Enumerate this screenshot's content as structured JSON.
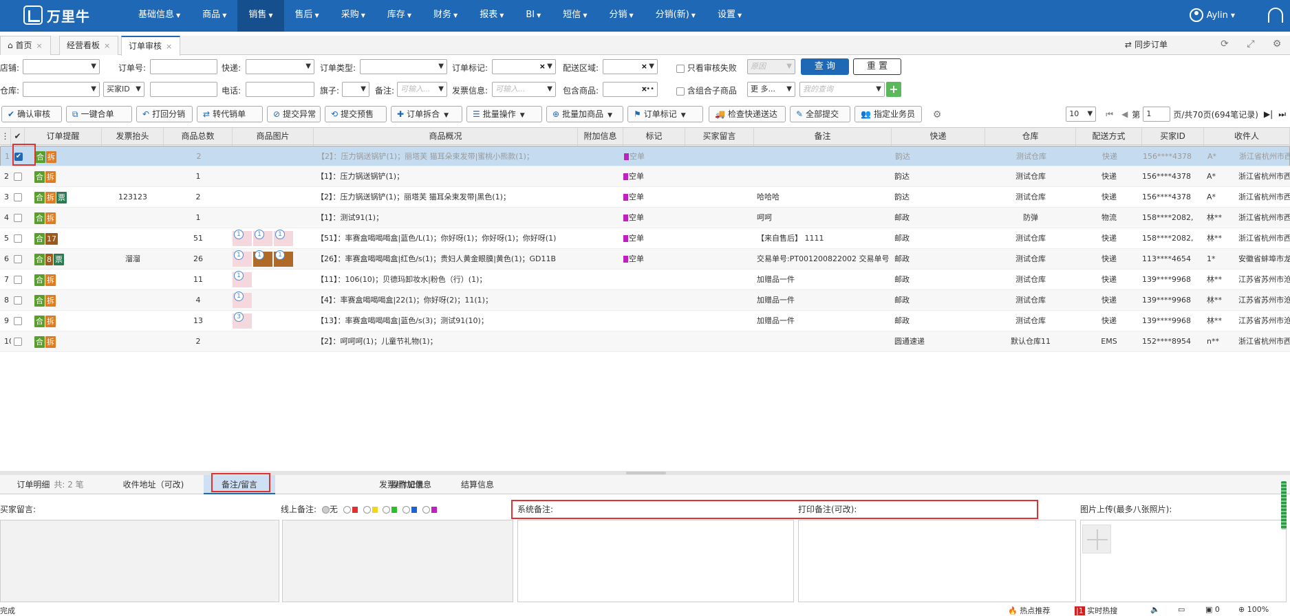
{
  "app": {
    "logo_text": "万里牛",
    "user": "Aylin"
  },
  "menu": [
    {
      "label": "基础信息"
    },
    {
      "label": "商品"
    },
    {
      "label": "销售",
      "active": true
    },
    {
      "label": "售后"
    },
    {
      "label": "采购"
    },
    {
      "label": "库存"
    },
    {
      "label": "财务"
    },
    {
      "label": "报表"
    },
    {
      "label": "BI"
    },
    {
      "label": "短信"
    },
    {
      "label": "分销"
    },
    {
      "label": "分销(新)"
    },
    {
      "label": "设置"
    }
  ],
  "tabs": [
    {
      "label": "首页"
    },
    {
      "label": "经营看板"
    },
    {
      "label": "订单审核",
      "active": true
    }
  ],
  "sync_label": "同步订单",
  "filters": {
    "row1": {
      "shop": "店铺:",
      "order_no": "订单号:",
      "express": "快递:",
      "order_type": "订单类型:",
      "order_mark": "订单标记:",
      "delivery_area": "配送区域:",
      "only_fail": "只看审核失败",
      "fail_select": "原因",
      "query": "查 询",
      "reset": "重 置"
    },
    "row2": {
      "warehouse": "仓库:",
      "buyer_id": "买家ID",
      "phone": "电话:",
      "flag": "旗子:",
      "remark": "备注:",
      "remark_ph": "可输入...",
      "invoice": "发票信息:",
      "invoice_ph": "可输入...",
      "contains": "包含商品:",
      "combo": "含组合子商品",
      "more": "更 多...",
      "my_query": "我的查询"
    }
  },
  "toolbar": [
    {
      "label": "确认审核",
      "icon": "check-icon"
    },
    {
      "label": "一键合单",
      "icon": "merge-icon"
    },
    {
      "label": "打回分销",
      "icon": "return-icon"
    },
    {
      "label": "转代销单",
      "icon": "transfer-icon"
    },
    {
      "label": "提交异常",
      "icon": "warning-icon"
    },
    {
      "label": "提交预售",
      "icon": "presale-icon"
    },
    {
      "label": "订单拆合",
      "icon": "split-icon",
      "dd": true
    },
    {
      "label": "批量操作",
      "icon": "list-icon",
      "dd": true
    },
    {
      "label": "批量加商品",
      "icon": "add-goods-icon",
      "dd": true
    },
    {
      "label": "订单标记",
      "icon": "bookmark-icon",
      "dd": true
    },
    {
      "label": "检查快递送达",
      "icon": "truck-icon"
    },
    {
      "label": "全部提交",
      "icon": "submit-icon"
    },
    {
      "label": "指定业务员",
      "icon": "staff-icon"
    }
  ],
  "pager": {
    "page_size": "10",
    "prefix": "第",
    "page": "1",
    "suffix": "页/共70页(694笔记录)"
  },
  "columns": [
    "订单提醒",
    "发票抬头",
    "商品总数",
    "商品图片",
    "商品概况",
    "附加信息",
    "标记",
    "买家留言",
    "备注",
    "快递",
    "仓库",
    "配送方式",
    "买家ID",
    "收件人"
  ],
  "rows": [
    {
      "no": "1",
      "tags": [
        {
          "t": "合",
          "c": "he"
        },
        {
          "t": "拆",
          "c": "chai"
        }
      ],
      "invoice": "",
      "qty": "2",
      "thumbs": [],
      "summary": "【2】：压力锅送锅铲(1)；丽塔芙 猫耳朵束发带|蜜桃小熊款(1)；",
      "mark": "空单",
      "msg": "",
      "remark": "",
      "express": "韵达",
      "wh": "测试仓库",
      "ship": "快递",
      "buyer": "156****4378",
      "recv": "A*",
      "addr": "浙江省杭州市西",
      "checked": true
    },
    {
      "no": "2",
      "tags": [
        {
          "t": "合",
          "c": "he"
        },
        {
          "t": "拆",
          "c": "chai"
        }
      ],
      "invoice": "",
      "qty": "1",
      "thumbs": [],
      "summary": "【1】：压力锅送锅铲(1)；",
      "mark": "空单",
      "msg": "",
      "remark": "",
      "express": "韵达",
      "wh": "测试仓库",
      "ship": "快递",
      "buyer": "156****4378",
      "recv": "A*",
      "addr": "浙江省杭州市西"
    },
    {
      "no": "3",
      "tags": [
        {
          "t": "合",
          "c": "he"
        },
        {
          "t": "拆",
          "c": "chai"
        },
        {
          "t": "票",
          "c": "piao"
        }
      ],
      "invoice": "123123",
      "qty": "2",
      "thumbs": [],
      "summary": "【2】：压力锅送锅铲(1)；丽塔芙 猫耳朵束发带|黑色(1)；",
      "mark": "空单",
      "msg": "",
      "remark": "哈哈哈",
      "express": "韵达",
      "wh": "测试仓库",
      "ship": "快递",
      "buyer": "156****4378",
      "recv": "A*",
      "addr": "浙江省杭州市西"
    },
    {
      "no": "4",
      "tags": [
        {
          "t": "合",
          "c": "he"
        },
        {
          "t": "拆",
          "c": "chai"
        }
      ],
      "invoice": "",
      "qty": "1",
      "thumbs": [],
      "summary": "【1】：测试91(1)；",
      "mark": "空单",
      "msg": "",
      "remark": "呵呵",
      "express": "邮政",
      "wh": "防弹",
      "ship": "物流",
      "buyer": "158****2082,",
      "recv": "林**",
      "addr": "浙江省杭州市西"
    },
    {
      "no": "5",
      "tags": [
        {
          "t": "合",
          "c": "he"
        },
        {
          "t": "17",
          "c": "num"
        }
      ],
      "invoice": "",
      "qty": "51",
      "thumbs": [
        "1",
        "1",
        "1"
      ],
      "summary": "【51】：率赛盒喝喝喝盒|蓝色/L(1)；你好呀(1)；你好呀(1)；你好呀(1)",
      "mark": "空单",
      "msg": "",
      "remark": "【来自售后】 1111",
      "express": "邮政",
      "wh": "测试仓库",
      "ship": "快递",
      "buyer": "158****2082,",
      "recv": "林**",
      "addr": "浙江省杭州市西"
    },
    {
      "no": "6",
      "tags": [
        {
          "t": "合",
          "c": "he"
        },
        {
          "t": "8",
          "c": "num"
        },
        {
          "t": "票",
          "c": "piao"
        }
      ],
      "invoice": "溜溜",
      "qty": "26",
      "thumbs": [
        "1",
        "1",
        "1"
      ],
      "summary": "【26】：率赛盒喝喝喝盒|红色/s(1)；贵妇人黄金眼膜|黄色(1)；GD11B",
      "mark": "空单",
      "msg": "",
      "remark": "交易单号:PT001200822002 交易单号",
      "express": "邮政",
      "wh": "测试仓库",
      "ship": "快递",
      "buyer": "113****4654",
      "recv": "1*",
      "addr": "安徽省蚌埠市龙"
    },
    {
      "no": "7",
      "tags": [
        {
          "t": "合",
          "c": "he"
        },
        {
          "t": "拆",
          "c": "chai"
        }
      ],
      "invoice": "",
      "qty": "11",
      "thumbs": [
        "1"
      ],
      "summary": "【11】：106(10)；贝德玛卸妆水|粉色（行）(1)；",
      "mark": "",
      "msg": "",
      "remark": "加赠品一件",
      "express": "邮政",
      "wh": "测试仓库",
      "ship": "快递",
      "buyer": "139****9968",
      "recv": "林**",
      "addr": "江苏省苏州市沧"
    },
    {
      "no": "8",
      "tags": [
        {
          "t": "合",
          "c": "he"
        },
        {
          "t": "拆",
          "c": "chai"
        }
      ],
      "invoice": "",
      "qty": "4",
      "thumbs": [
        "1"
      ],
      "summary": "【4】：率赛盒喝喝喝盒|22(1)；你好呀(2)；11(1)；",
      "mark": "",
      "msg": "",
      "remark": "加赠品一件",
      "express": "邮政",
      "wh": "测试仓库",
      "ship": "快递",
      "buyer": "139****9968",
      "recv": "林**",
      "addr": "江苏省苏州市沧"
    },
    {
      "no": "9",
      "tags": [
        {
          "t": "合",
          "c": "he"
        },
        {
          "t": "拆",
          "c": "chai"
        }
      ],
      "invoice": "",
      "qty": "13",
      "thumbs": [
        "3"
      ],
      "summary": "【13】：率赛盒喝喝喝盒|蓝色/s(3)；测试91(10)；",
      "mark": "",
      "msg": "",
      "remark": "加赠品一件",
      "express": "邮政",
      "wh": "测试仓库",
      "ship": "快递",
      "buyer": "139****9968",
      "recv": "林**",
      "addr": "江苏省苏州市沧"
    },
    {
      "no": "10",
      "tags": [
        {
          "t": "合",
          "c": "he"
        },
        {
          "t": "拆",
          "c": "chai"
        }
      ],
      "invoice": "",
      "qty": "2",
      "thumbs": [],
      "summary": "【2】：呵呵呵(1)；儿童节礼物(1)；",
      "mark": "",
      "msg": "",
      "remark": "",
      "express": "圆通速递",
      "wh": "默认仓库11",
      "ship": "EMS",
      "buyer": "152****8954",
      "recv": "n**",
      "addr": "浙江省杭州市西"
    }
  ],
  "bottom": {
    "tabs": [
      {
        "label": "订单明细",
        "sub": "共: 2 笔"
      },
      {
        "label": "收件地址（可改)"
      },
      {
        "label": "备注/留言",
        "active": true
      },
      {
        "label": "发票/附加信息"
      },
      {
        "label": "操作记录"
      },
      {
        "label": "结算信息"
      }
    ],
    "buyer_msg": "买家留言:",
    "online_remark": "线上备注:",
    "radio_none": "无",
    "sys_remark": "系统备注:",
    "print_remark": "打印备注(可改):",
    "upload": "图片上传(最多八张照片):"
  },
  "status": {
    "left": "完成",
    "hot": "热点推荐",
    "realtime": "实时热搜",
    "count": "0",
    "zoom": "100%"
  },
  "colors": {
    "nav": "#1f68b5",
    "selected_row": "#c5dcf0",
    "highlight": "#e03030"
  }
}
